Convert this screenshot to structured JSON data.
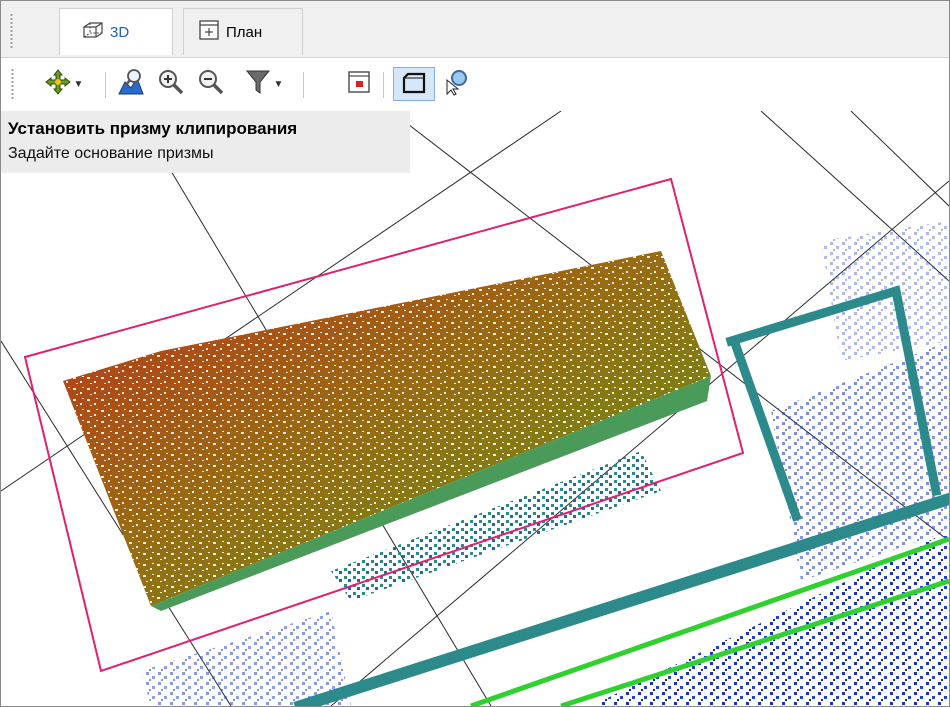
{
  "tabs": [
    {
      "label": "3D",
      "icon": "cube-icon",
      "active": true
    },
    {
      "label": "План",
      "icon": "plan-icon",
      "active": false
    }
  ],
  "toolbar": {
    "buttons": [
      {
        "name": "pan-navigation-button",
        "icon": "move-arrows-icon",
        "dropdown": true
      },
      {
        "name": "zoom-extents-button",
        "icon": "zoom-extents-icon"
      },
      {
        "name": "zoom-in-button",
        "icon": "zoom-in-icon"
      },
      {
        "name": "zoom-out-button",
        "icon": "zoom-out-icon"
      },
      {
        "name": "filter-button",
        "icon": "filter-icon",
        "dropdown": true
      },
      {
        "name": "clip-box-button",
        "icon": "clip-box-icon"
      },
      {
        "name": "clip-prism-button",
        "icon": "clip-prism-icon",
        "pressed": true
      },
      {
        "name": "select-point-button",
        "icon": "select-zoom-icon"
      }
    ]
  },
  "hint": {
    "title": "Установить призму клипирования",
    "subtitle": "Задайте основание призмы"
  },
  "colors": {
    "prism_outline": "#e0206e",
    "grid_line": "#2a2a2a",
    "scan_red": "#c0301a",
    "scan_green": "#6a9a1a",
    "cloud_blue": "#1830c8",
    "cloud_teal": "#2c8a8a",
    "rail_green": "#30d030"
  }
}
